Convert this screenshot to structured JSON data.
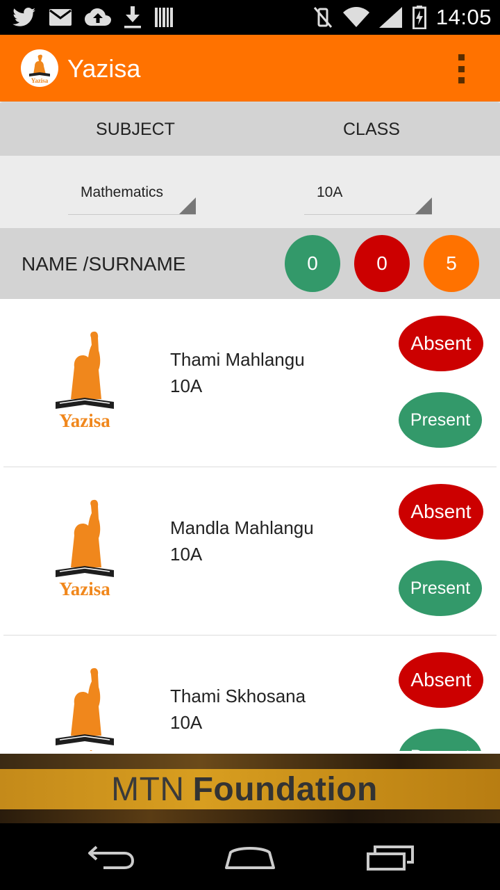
{
  "status_bar": {
    "time": "14:05",
    "left_icons": [
      "twitter-icon",
      "gmail-icon",
      "cloud-upload-icon",
      "download-icon",
      "barcode-icon"
    ],
    "right_icons": [
      "vibrate-off-icon",
      "wifi-icon",
      "signal-icon",
      "battery-charging-icon"
    ]
  },
  "app_bar": {
    "title": "Yazisa",
    "logo_text": "Yazisa",
    "menu_icon": "overflow-menu-icon",
    "color": "#ff7200"
  },
  "tabs": {
    "subject_label": "SUBJECT",
    "class_label": "CLASS"
  },
  "filters": {
    "subject_value": "Mathematics",
    "class_value": "10A"
  },
  "list_header": {
    "title": "NAME /SURNAME",
    "present_count": "0",
    "absent_count": "0",
    "total_count": "5"
  },
  "students": [
    {
      "name": "Thami Mahlangu",
      "class": "10A",
      "absent_label": "Absent",
      "present_label": "Present"
    },
    {
      "name": "Mandla Mahlangu",
      "class": "10A",
      "absent_label": "Absent",
      "present_label": "Present"
    },
    {
      "name": "Thami Skhosana",
      "class": "10A",
      "absent_label": "Absent",
      "present_label": "Present"
    }
  ],
  "avatar_logo_text": "Yazisa",
  "banner": {
    "text_regular": "MTN",
    "text_bold": "Foundation"
  },
  "nav_bar": {
    "icons": [
      "back-icon",
      "home-icon",
      "recents-icon"
    ]
  },
  "colors": {
    "accent": "#ff7200",
    "present": "#33996a",
    "absent": "#cc0000"
  }
}
